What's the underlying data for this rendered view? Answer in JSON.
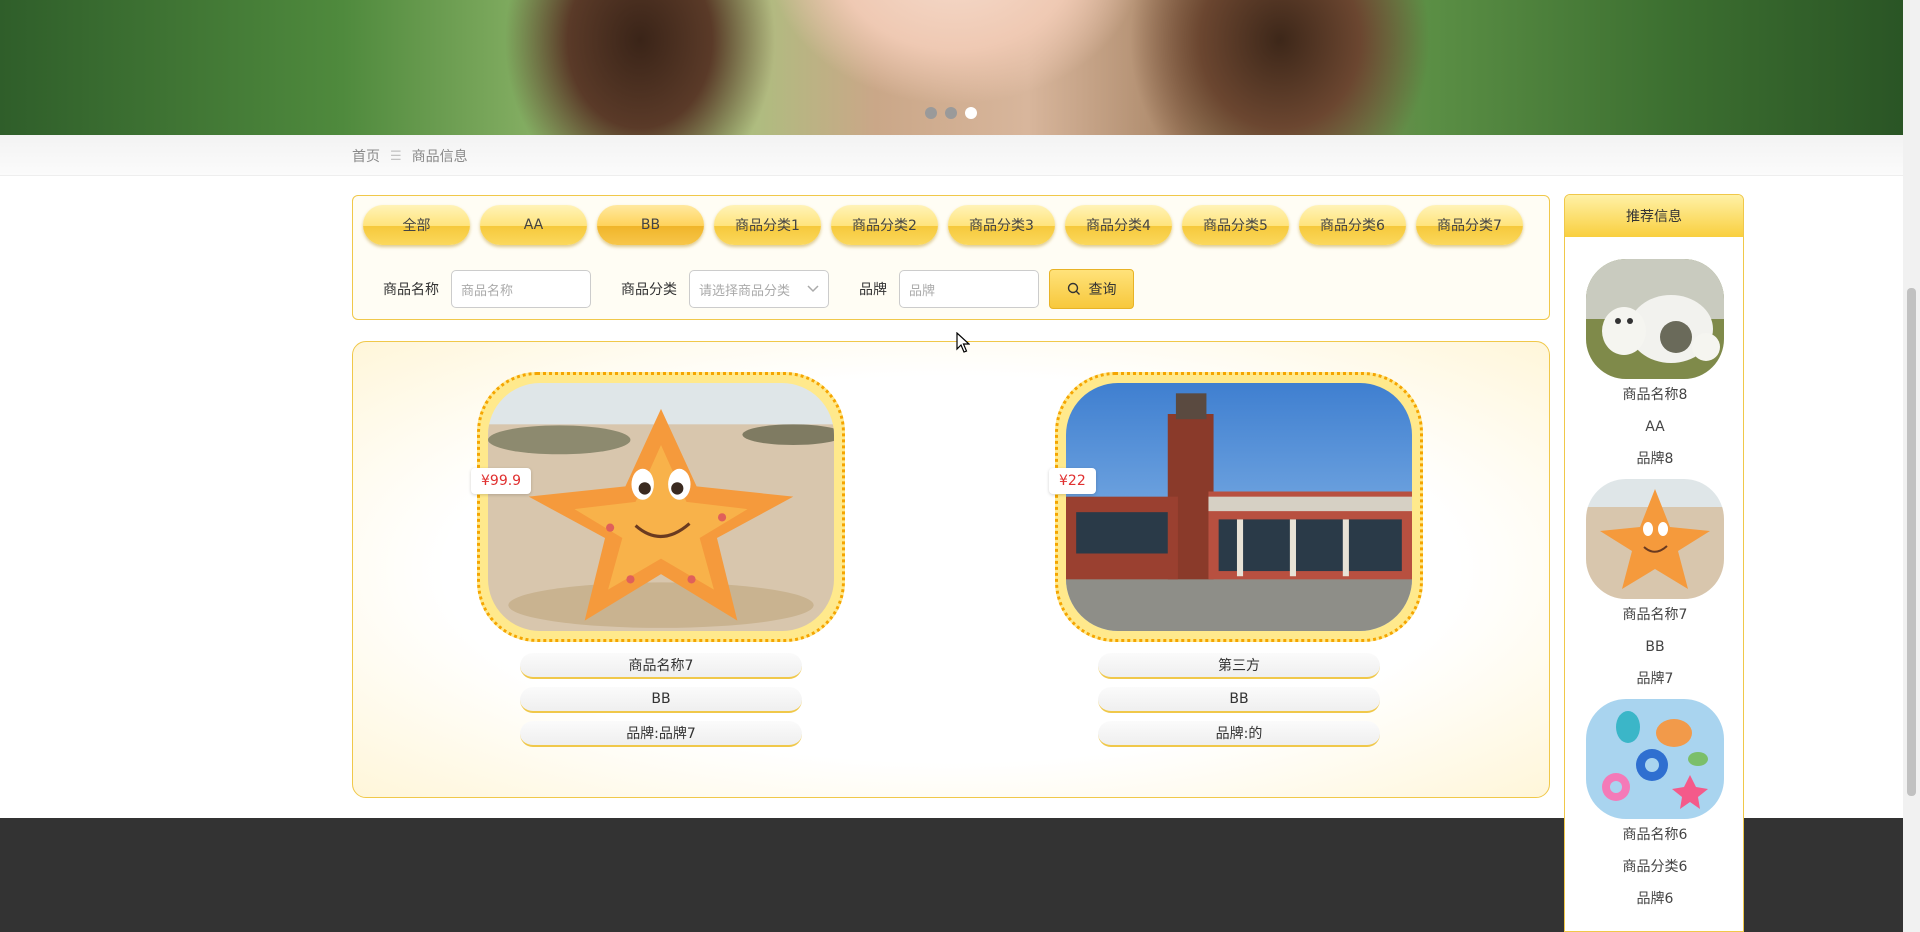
{
  "breadcrumb": {
    "home": "首页",
    "separator": "☰",
    "current": "商品信息"
  },
  "categories": [
    "全部",
    "AA",
    "BB",
    "商品分类1",
    "商品分类2",
    "商品分类3",
    "商品分类4",
    "商品分类5",
    "商品分类6",
    "商品分类7"
  ],
  "active_category": "BB",
  "filters": {
    "name_label": "商品名称",
    "name_placeholder": "商品名称",
    "category_label": "商品分类",
    "category_placeholder": "请选择商品分类",
    "brand_label": "品牌",
    "brand_placeholder": "品牌",
    "search_label": "查询"
  },
  "products": [
    {
      "price": "¥99.9",
      "name": "商品名称7",
      "category": "BB",
      "brand": "品牌:品牌7",
      "image": "orange-starfish-on-beach"
    },
    {
      "price": "¥22",
      "name": "第三方",
      "category": "BB",
      "brand": "品牌:的",
      "image": "red-brick-building-plaza"
    }
  ],
  "recommend": {
    "title": "推荐信息",
    "items": [
      {
        "name": "商品名称8",
        "category": "AA",
        "brand": "品牌8",
        "image": "white-bear-figurines"
      },
      {
        "name": "商品名称7",
        "category": "BB",
        "brand": "品牌7",
        "image": "orange-starfish"
      },
      {
        "name": "商品名称6",
        "category": "商品分类6",
        "brand": "品牌6",
        "image": "beach-toys"
      }
    ]
  },
  "carousel": {
    "count": 3,
    "active_index": 2
  },
  "colors": {
    "accent": "#f7c83c",
    "border": "#f0c84a",
    "price": "#e03030",
    "footer": "#333333"
  }
}
